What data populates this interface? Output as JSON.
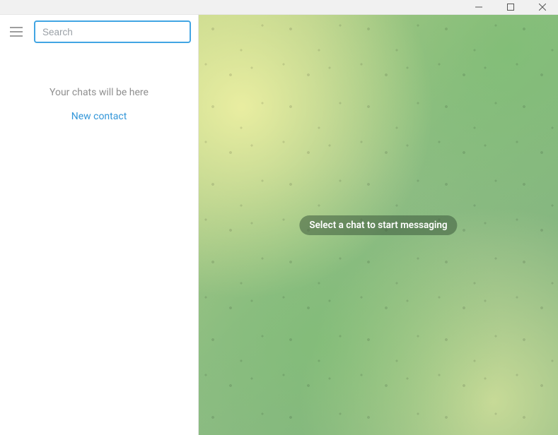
{
  "search": {
    "placeholder": "Search",
    "value": ""
  },
  "sidebar": {
    "chats_hint": "Your chats will be here",
    "new_contact": "New contact"
  },
  "main": {
    "empty_hint": "Select a chat to start messaging"
  }
}
